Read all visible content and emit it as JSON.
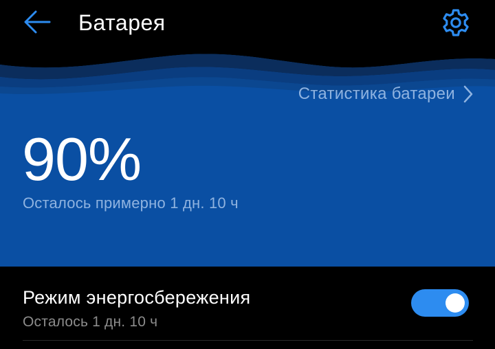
{
  "app_bar": {
    "title": "Батарея",
    "back_icon": "back-arrow-icon",
    "settings_icon": "gear-icon"
  },
  "hero": {
    "stats_link_label": "Статистика батареи",
    "stats_link_icon": "chevron-right-icon",
    "battery_percent": "90%",
    "battery_level": 90,
    "remaining_text": "Осталось примерно 1 дн. 10 ч"
  },
  "power_saving": {
    "title": "Режим энергосбережения",
    "subtitle": "Осталось 1 дн. 10 ч",
    "enabled": true
  },
  "colors": {
    "background": "#000000",
    "hero_blue": "#0a4fa3",
    "accent": "#2d8cf0",
    "hero_secondary_text": "#8fb3e0",
    "secondary_text": "#8c8c8c"
  }
}
